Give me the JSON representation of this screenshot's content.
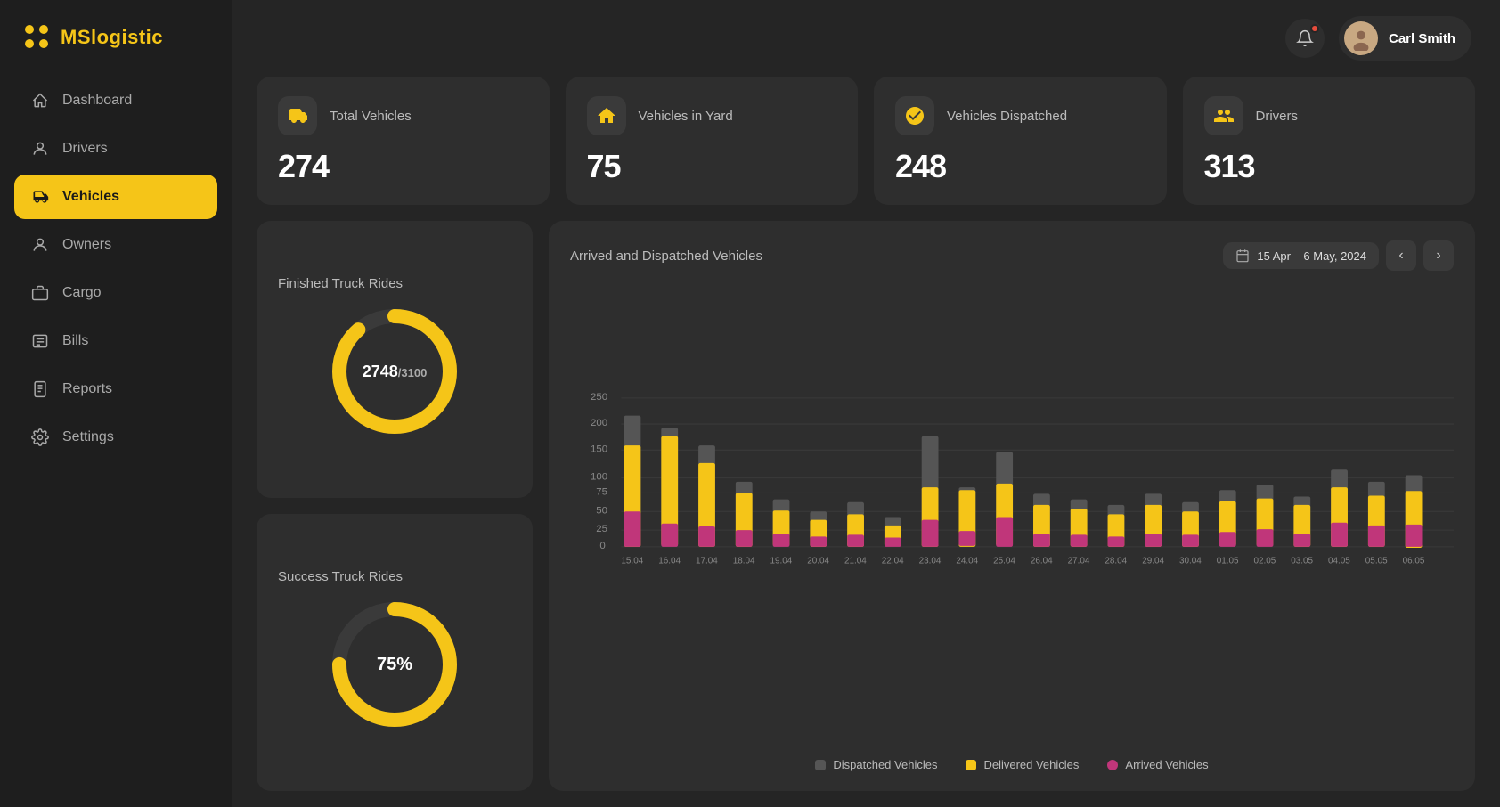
{
  "app": {
    "name": "MSlogistic"
  },
  "header": {
    "user_name": "Carl Smith"
  },
  "sidebar": {
    "items": [
      {
        "label": "Dashboard",
        "icon": "home-icon",
        "active": false
      },
      {
        "label": "Drivers",
        "icon": "drivers-icon",
        "active": false
      },
      {
        "label": "Vehicles",
        "icon": "vehicles-icon",
        "active": true
      },
      {
        "label": "Owners",
        "icon": "owners-icon",
        "active": false
      },
      {
        "label": "Cargo",
        "icon": "cargo-icon",
        "active": false
      },
      {
        "label": "Bills",
        "icon": "bills-icon",
        "active": false
      },
      {
        "label": "Reports",
        "icon": "reports-icon",
        "active": false
      },
      {
        "label": "Settings",
        "icon": "settings-icon",
        "active": false
      }
    ]
  },
  "stats": [
    {
      "label": "Total Vehicles",
      "value": "274",
      "icon": "truck-icon"
    },
    {
      "label": "Vehicles in Yard",
      "value": "75",
      "icon": "yard-icon"
    },
    {
      "label": "Vehicles Dispatched",
      "value": "248",
      "icon": "dispatch-icon"
    },
    {
      "label": "Drivers",
      "value": "313",
      "icon": "drivers-stat-icon"
    }
  ],
  "finished_rides": {
    "title": "Finished Truck Rides",
    "current": 2748,
    "total": 3100,
    "label": "2748/",
    "sub_label": "3100",
    "percentage": 88.6
  },
  "success_rides": {
    "title": "Success Truck Rides",
    "label": "75%",
    "percentage": 75
  },
  "bar_chart": {
    "title": "Arrived and Dispatched Vehicles",
    "date_range": "15 Apr – 6 May, 2024",
    "y_labels": [
      "250",
      "200",
      "150",
      "100",
      "75",
      "50",
      "25",
      "0"
    ],
    "legend": [
      {
        "label": "Dispatched Vehicles",
        "color": "#555"
      },
      {
        "label": "Delivered Vehicles",
        "color": "#f5c518"
      },
      {
        "label": "Arrived Vehicles",
        "color": "#c0367a"
      }
    ],
    "dates": [
      "15.04",
      "16.04",
      "17.04",
      "18.04",
      "19.04",
      "20.04",
      "21.04",
      "22.04",
      "23.04",
      "24.04",
      "25.04",
      "26.04",
      "27.04",
      "28.04",
      "29.04",
      "30.04",
      "01.05",
      "02.05",
      "03.05",
      "04.05",
      "05.05",
      "06.05"
    ],
    "bars": [
      {
        "dispatched": 220,
        "delivered": 170,
        "arrived": 60
      },
      {
        "dispatched": 200,
        "delivered": 185,
        "arrived": 40
      },
      {
        "dispatched": 170,
        "delivered": 140,
        "arrived": 35
      },
      {
        "dispatched": 110,
        "delivered": 90,
        "arrived": 28
      },
      {
        "dispatched": 80,
        "delivered": 60,
        "arrived": 22
      },
      {
        "dispatched": 60,
        "delivered": 45,
        "arrived": 18
      },
      {
        "dispatched": 75,
        "delivered": 55,
        "arrived": 20
      },
      {
        "dispatched": 50,
        "delivered": 35,
        "arrived": 15
      },
      {
        "dispatched": 185,
        "delivered": 100,
        "arrived": 45
      },
      {
        "dispatched": 100,
        "delivered": 95,
        "arrived": 25
      },
      {
        "dispatched": 160,
        "delivered": 105,
        "arrived": 50
      },
      {
        "dispatched": 90,
        "delivered": 70,
        "arrived": 22
      },
      {
        "dispatched": 80,
        "delivered": 65,
        "arrived": 20
      },
      {
        "dispatched": 70,
        "delivered": 55,
        "arrived": 18
      },
      {
        "dispatched": 90,
        "delivered": 70,
        "arrived": 22
      },
      {
        "dispatched": 75,
        "delivered": 60,
        "arrived": 20
      },
      {
        "dispatched": 95,
        "delivered": 75,
        "arrived": 25
      },
      {
        "dispatched": 105,
        "delivered": 80,
        "arrived": 30
      },
      {
        "dispatched": 85,
        "delivered": 70,
        "arrived": 22
      },
      {
        "dispatched": 130,
        "delivered": 100,
        "arrived": 40
      },
      {
        "dispatched": 110,
        "delivered": 85,
        "arrived": 35
      },
      {
        "dispatched": 120,
        "delivered": 95,
        "arrived": 38
      }
    ]
  }
}
